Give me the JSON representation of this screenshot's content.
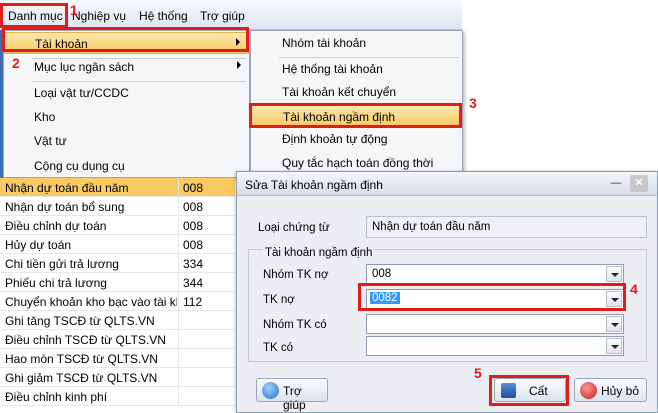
{
  "menubar": {
    "items": [
      "Danh mục",
      "Nghiệp vụ",
      "Hệ thống",
      "Trợ giúp"
    ]
  },
  "submenu1": {
    "items": [
      "Tài khoản",
      "Mục lục ngân sách",
      "Loại vật tư/CCDC",
      "Kho",
      "Vật tư",
      "Cộng cụ dụng cụ"
    ]
  },
  "submenu2": {
    "items": [
      "Nhóm tài khoản",
      "Hệ thống tài khoản",
      "Tài khoản kết chuyển",
      "Tài khoản ngầm định",
      "Định khoản tự động",
      "Quy tắc hạch toán đồng thời"
    ]
  },
  "step_numbers": [
    "1",
    "2",
    "3",
    "4",
    "5"
  ],
  "list": {
    "rows": [
      {
        "name": "Nhận dự toán đầu năm",
        "code": "008"
      },
      {
        "name": "Nhận dự toán bổ sung",
        "code": "008"
      },
      {
        "name": "Điều chỉnh dự toán",
        "code": "008"
      },
      {
        "name": "Hủy dự toán",
        "code": "008"
      },
      {
        "name": "Chi tiền gửi trả lương",
        "code": "334"
      },
      {
        "name": "Phiếu chi trả lương",
        "code": "344"
      },
      {
        "name": "Chuyển khoản kho bạc vào tài kh",
        "code": "112"
      },
      {
        "name": "Ghi tăng TSCĐ từ QLTS.VN",
        "code": ""
      },
      {
        "name": "Điều chỉnh TSCĐ từ QLTS.VN",
        "code": ""
      },
      {
        "name": "Hao mòn TSCĐ từ QLTS.VN",
        "code": ""
      },
      {
        "name": "Ghi giảm TSCĐ từ QLTS.VN",
        "code": ""
      },
      {
        "name": "Điều chỉnh kinh phí",
        "code": ""
      }
    ]
  },
  "dialog": {
    "title": "Sửa Tài khoản ngầm định",
    "loai_chung_tu_label": "Loại chứng từ",
    "loai_chung_tu_value": "Nhận dự toán đầu năm",
    "group_label": "Tài khoản ngầm định",
    "nhom_tk_no_label": "Nhóm TK nợ",
    "nhom_tk_no_value": "008",
    "tk_no_label": "TK nợ",
    "tk_no_value": "0082",
    "nhom_tk_co_label": "Nhóm TK có",
    "nhom_tk_co_value": "",
    "tk_co_label": "TK có",
    "tk_co_value": "",
    "help_button": "Trợ giúp",
    "save_button": "Cất",
    "cancel_button": "Hủy bỏ"
  },
  "colors": {
    "highlight_red": "#e11c1c",
    "menu_selection": "#f9c962",
    "text_selection": "#3399ff"
  },
  "icons": [
    "close-icon",
    "minimize-icon",
    "submenu-arrow-icon",
    "dropdown-arrow-icon",
    "help-icon",
    "save-icon",
    "cancel-icon"
  ]
}
